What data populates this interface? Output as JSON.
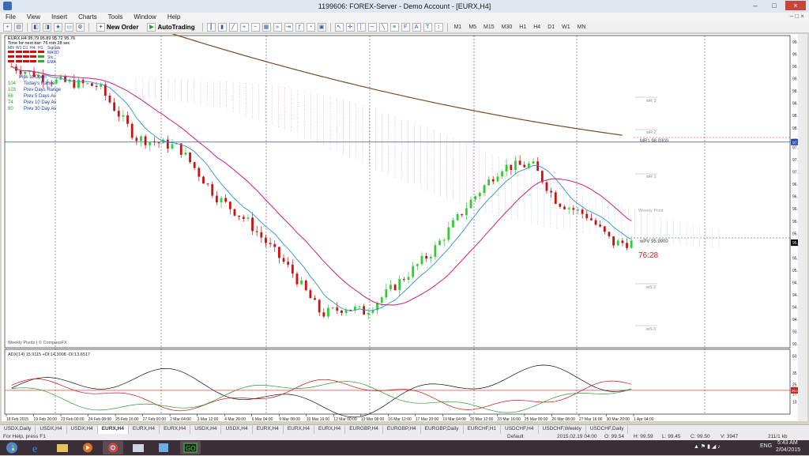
{
  "window": {
    "title": "1199606: FOREX-Server - Demo Account - [EURX,H4]",
    "buttons": [
      "–",
      "□",
      "×"
    ]
  },
  "menu": {
    "items": [
      "File",
      "View",
      "Insert",
      "Charts",
      "Tools",
      "Window",
      "Help"
    ],
    "right": "– □ ×"
  },
  "toolbar": {
    "new_order": "New Order",
    "autotrading": "AutoTrading",
    "timeframes": [
      "M1",
      "M5",
      "M15",
      "M30",
      "H1",
      "H4",
      "D1",
      "W1",
      "MN"
    ]
  },
  "chart": {
    "symbol_line": "EURX,H4 95.79 95.89 95.72 95.76",
    "timer": "Time for next bar: 76 min 28 sec",
    "signals_row": [
      "MN",
      "W1",
      "D1",
      "H4",
      "H1",
      "Signals"
    ],
    "signals_labels": [
      "MACD",
      "Stc",
      "EMA"
    ],
    "pips_title": "Pips to Open",
    "range_rows": [
      {
        "v": "104",
        "label": "Today's Range"
      },
      {
        "v": "103",
        "label": "Prev Days Range"
      },
      {
        "v": "66",
        "label": "Prev 5 Days Av"
      },
      {
        "v": "74",
        "label": "Prev 10 Day Av"
      },
      {
        "v": "80",
        "label": "Prev 30 Day Av"
      }
    ],
    "pivot_labels": {
      "wr3": "wR 3",
      "wr2": "wR 2",
      "mr1": "MR1  98.0300",
      "wr1": "wR 1",
      "weekly_pivot": "Weekly Pivot",
      "wpv": "wPV  95.9900",
      "ws2": "wS 2",
      "ws3": "wS 3"
    },
    "countdown": "76:28",
    "weekly_pivots_credit": "Weekly Pivots | © CompassFX",
    "price_axis": [
      "99.85",
      "99.60",
      "99.35",
      "99.10",
      "98.85",
      "98.60",
      "98.35",
      "98.10",
      "97.85",
      "97.70",
      "97.45",
      "97.20",
      "96.95",
      "96.70",
      "96.45",
      "96.20",
      "95.95",
      "95.76",
      "95.45",
      "95.20",
      "94.95",
      "94.70",
      "94.45",
      "94.20",
      "93.95",
      "93.70"
    ],
    "current_price": "95.76",
    "blue_line_price": "97.81",
    "time_axis": [
      "18 Feb 2015",
      "19 Feb 20:00",
      "23 Feb 00:00",
      "24 Feb 08:00",
      "25 Feb 16:00",
      "27 Feb 00:00",
      "2 Mar 04:00",
      "3 Mar 12:00",
      "4 Mar 20:00",
      "6 Mar 04:00",
      "9 Mar 08:00",
      "10 Mar 16:00",
      "12 Mar 00:00",
      "13 Mar 08:00",
      "16 Mar 12:00",
      "17 Mar 20:00",
      "19 Mar 04:00",
      "20 Mar 12:00",
      "23 Mar 16:00",
      "25 Mar 00:00",
      "26 Mar 08:00",
      "27 Mar 16:00",
      "30 Mar 20:00",
      "1 Apr 04:00"
    ],
    "adx_label": "ADX(14) 15.9115 +DI:14.3008 -DI:13.6517",
    "adx_axis": [
      "50",
      "35",
      "25",
      "20",
      "17",
      "10"
    ],
    "adx_threshold": "20.0000"
  },
  "tabs": [
    "USDX,Daily",
    "USDX,H4",
    "USDX,H4",
    "EURX,H4",
    "EURX,H4",
    "EURX,H4",
    "USDX,H4",
    "USDX,H4",
    "EURX,H4",
    "EURX,H4",
    "EURX,H4",
    "EURGBP,H4",
    "EURGBP,H4",
    "EURGBP,Daily",
    "EURCHF,H1",
    "USDCHF,H4",
    "USDCHF,Weekly",
    "USDCHF,Daily"
  ],
  "active_tab_index": 3,
  "status": {
    "help": "For Help, press F1",
    "profile": "Default",
    "datetime": "2015.02.19 04:00",
    "o": "O: 99.54",
    "h": "H: 99.59",
    "l": "L: 99.45",
    "c": "C: 99.50",
    "v": "V: 3947",
    "traffic": "211/1 kb"
  },
  "taskbar": {
    "lang": "ENG",
    "time": "5:43 AM",
    "date": "2/04/2015"
  },
  "colors": {
    "ema_brown": "#7a4a24",
    "kijun_magenta": "#d0307f",
    "tenkan_blue": "#2f8fd6",
    "bull_candle": "#33cc33",
    "bear_candle": "#cc1111",
    "cloud_magenta": "#c060c0",
    "cloud_blue": "#6a9ee0",
    "pivot_gray": "#888888",
    "mr1_red": "#cc2222"
  }
}
